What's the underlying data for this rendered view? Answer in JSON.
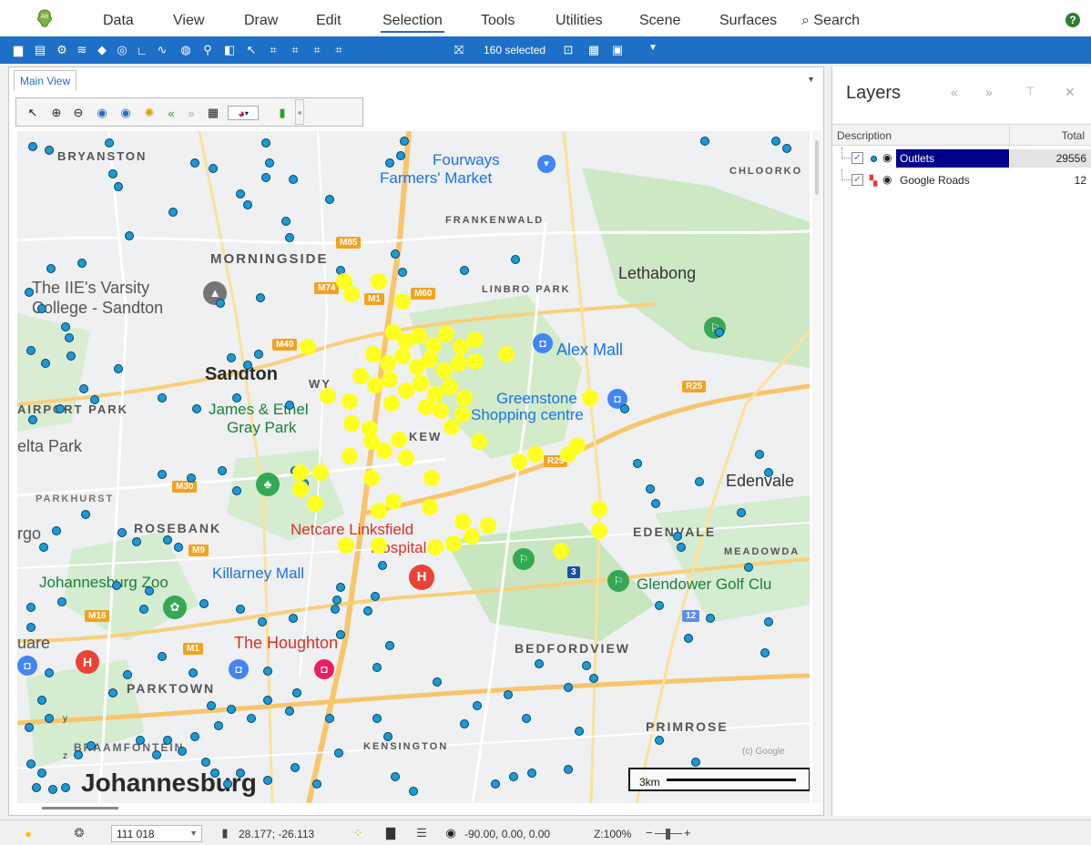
{
  "menu": {
    "items": [
      "Data",
      "View",
      "Draw",
      "Edit",
      "Selection",
      "Tools",
      "Utilities",
      "Scene",
      "Surfaces"
    ],
    "active": "Selection",
    "search_label": "Search"
  },
  "toolbar": {
    "selected_label": "160 selected"
  },
  "document": {
    "tab_label": "Main View"
  },
  "map": {
    "labels": {
      "bryanston": "BRYANSTON",
      "fourways": "Fourways",
      "farmers_market": "Farmers' Market",
      "chloorkop": "CHLOORKO",
      "frankenwald": "FRANKENWALD",
      "morningside": "MORNINGSIDE",
      "lethabong": "Lethabong",
      "linbro_park": "LINBRO PARK",
      "varsity_1": "The IIE's Varsity",
      "varsity_2": "College - Sandton",
      "alex_mall": "Alex Mall",
      "sandton": "Sandton",
      "wynberg": "WY",
      "greenstone_1": "Greenstone",
      "greenstone_2": "Shopping centre",
      "airport": "AIRPORT PARK",
      "james_ethel_1": "James & Ethel",
      "james_ethel_2": "Gray Park",
      "kew": "KEW",
      "melta_park": "elta Park",
      "edenvale": "Edenvale",
      "parkhurst": "PARKHURST",
      "rosebank": "ROSEBANK",
      "netcare_1": "Netcare Linksfield",
      "netcare_2": "Hospital",
      "edenvale_caps": "EDENVALE",
      "meadowdale": "MEADOWDA",
      "zoo": "Johannesburg Zoo",
      "killarney": "Killarney Mall",
      "glendower": "Glendower Golf Clu",
      "square": "uare",
      "houghton": "The Houghton",
      "bedfordview": "BEDFORDVIEW",
      "parktown": "PARKTOWN",
      "primrose": "PRIMROSE",
      "braamfontein": "BRAAMFONTEIN",
      "kensington": "KENSINGTON",
      "johannesburg": "Johannesburg",
      "rgo": "rgo"
    },
    "shields": {
      "m85": "M85",
      "m74": "M74",
      "m1a": "M1",
      "m60": "M60",
      "m40": "M40",
      "r25": "R25",
      "m30": "M30",
      "m9": "M9",
      "m16": "M16",
      "m1b": "M1",
      "r25b": "R25",
      "n12": "12",
      "n3": "3"
    },
    "copyright": "(c) Google",
    "scale_label": "3km",
    "axis_y": "y",
    "axis_z": "z"
  },
  "layers": {
    "title": "Layers",
    "col_description": "Description",
    "col_total": "Total",
    "rows": [
      {
        "name": "Outlets",
        "total": "29556"
      },
      {
        "name": "Google Roads",
        "total": "12"
      }
    ]
  },
  "status": {
    "scale_value": "111 018",
    "coordinates": "28.177; -26.113",
    "rotation": "-90.00, 0.00, 0.00",
    "zoom": "Z:100%"
  },
  "colors": {
    "toolbar_blue": "#1e6fc7",
    "outlet_blue": "#1a9ad6",
    "selected_yellow": "#ffff20",
    "layer_selected": "#00008b"
  }
}
